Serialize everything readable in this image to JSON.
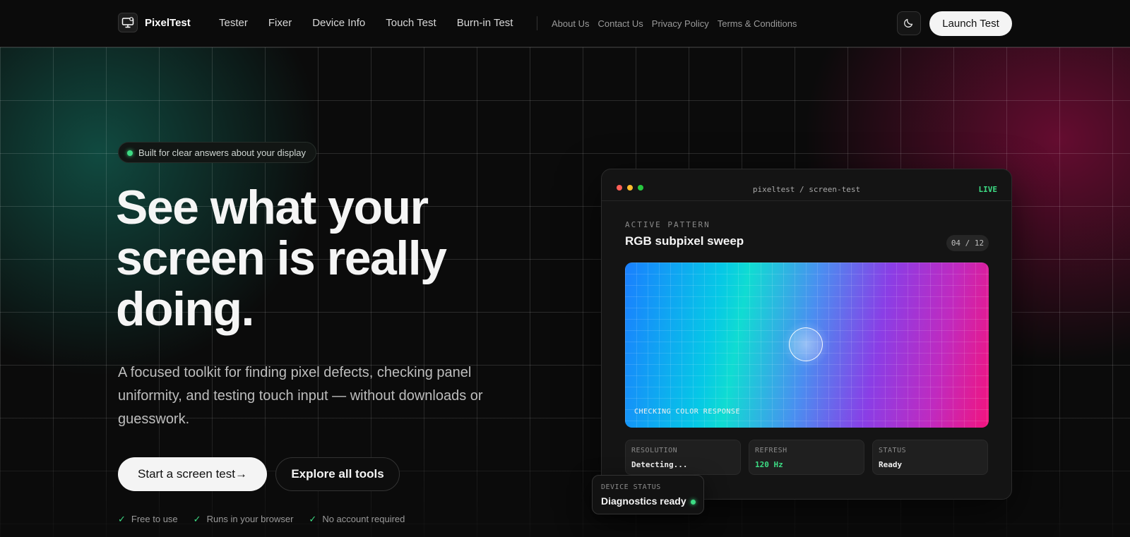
{
  "header": {
    "brand": "PixelTest",
    "nav": [
      "Tester",
      "Fixer",
      "Device Info",
      "Touch Test",
      "Burn-in Test"
    ],
    "subnav": [
      "About Us",
      "Contact Us",
      "Privacy Policy",
      "Terms & Conditions"
    ],
    "launch_label": "Launch Test"
  },
  "hero": {
    "badge": "Built for clear answers about your display",
    "headline": "See what your screen is really doing.",
    "subcopy": "A focused toolkit for finding pixel defects, checking panel uniformity, and testing touch input — without downloads or guesswork.",
    "cta_primary": "Start a screen test→",
    "cta_secondary": "Explore all tools",
    "features": [
      "Free to use",
      "Runs in your browser",
      "No account required"
    ]
  },
  "panel": {
    "path": "pixeltest / screen-test",
    "live": "LIVE",
    "active_label": "ACTIVE PATTERN",
    "pattern_title": "RGB subpixel sweep",
    "pattern_count": "04 / 12",
    "sweep_caption": "CHECKING COLOR RESPONSE",
    "stats": [
      {
        "label": "RESOLUTION",
        "value": "Detecting..."
      },
      {
        "label": "REFRESH",
        "value": "120 Hz"
      },
      {
        "label": "STATUS",
        "value": "Ready"
      }
    ]
  },
  "device": {
    "label": "DEVICE STATUS",
    "value": "Diagnostics ready"
  },
  "colors": {
    "accent_green": "#3ddc84",
    "background": "#0b0b0b",
    "teal_glow": "#125f52",
    "magenta_glow": "#820c3c"
  },
  "icons": {
    "logo": "monitor-icon",
    "theme_toggle": "moon-icon",
    "feature": "check-icon"
  }
}
